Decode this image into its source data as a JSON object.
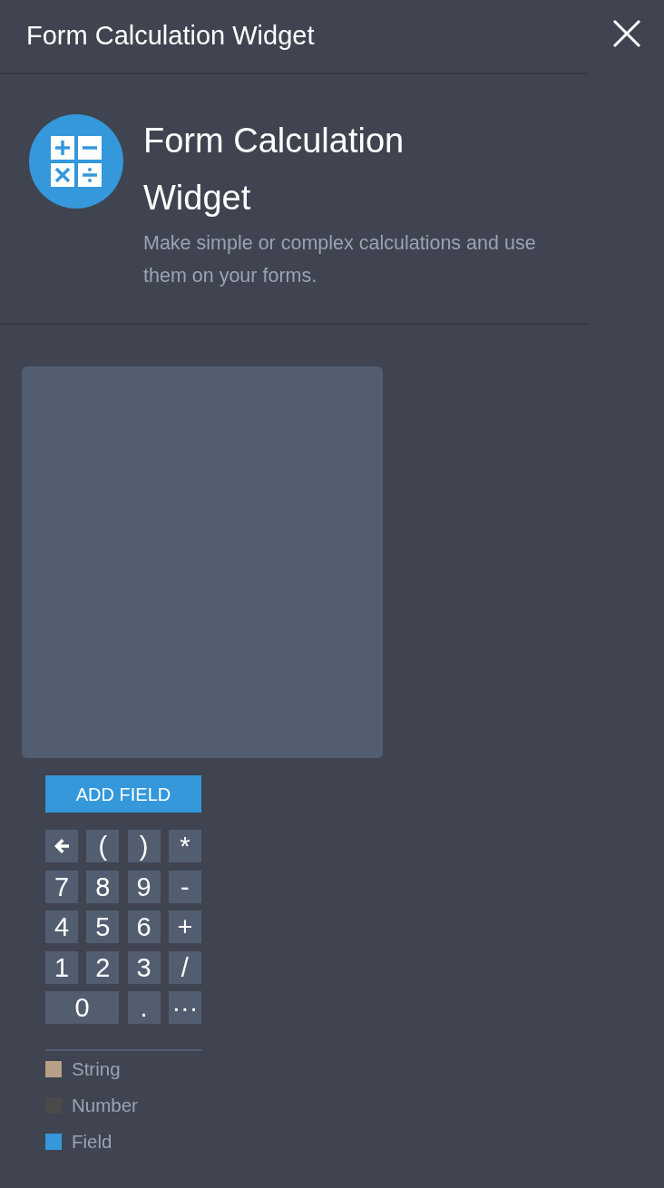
{
  "header": {
    "title": "Form Calculation Widget"
  },
  "widget": {
    "title": "Form Calculation Widget",
    "description": "Make simple or complex calculations and use them on your forms."
  },
  "add_field_button": "ADD FIELD",
  "keypad": [
    {
      "kind": "backspace"
    },
    {
      "kind": "text",
      "label": "("
    },
    {
      "kind": "text",
      "label": ")"
    },
    {
      "kind": "text",
      "label": "*"
    },
    {
      "kind": "text",
      "label": "7"
    },
    {
      "kind": "text",
      "label": "8"
    },
    {
      "kind": "text",
      "label": "9"
    },
    {
      "kind": "text",
      "label": "-"
    },
    {
      "kind": "text",
      "label": "4"
    },
    {
      "kind": "text",
      "label": "5"
    },
    {
      "kind": "text",
      "label": "6"
    },
    {
      "kind": "text",
      "label": "+"
    },
    {
      "kind": "text",
      "label": "1"
    },
    {
      "kind": "text",
      "label": "2"
    },
    {
      "kind": "text",
      "label": "3"
    },
    {
      "kind": "text",
      "label": "/"
    },
    {
      "kind": "wide",
      "label": "0"
    },
    {
      "kind": "text",
      "label": "."
    },
    {
      "kind": "text",
      "label": "···"
    }
  ],
  "legend": [
    {
      "label": "String",
      "color": "#b8a088"
    },
    {
      "label": "Number",
      "color": "#4a4a4a"
    },
    {
      "label": "Field",
      "color": "#3498db"
    }
  ]
}
